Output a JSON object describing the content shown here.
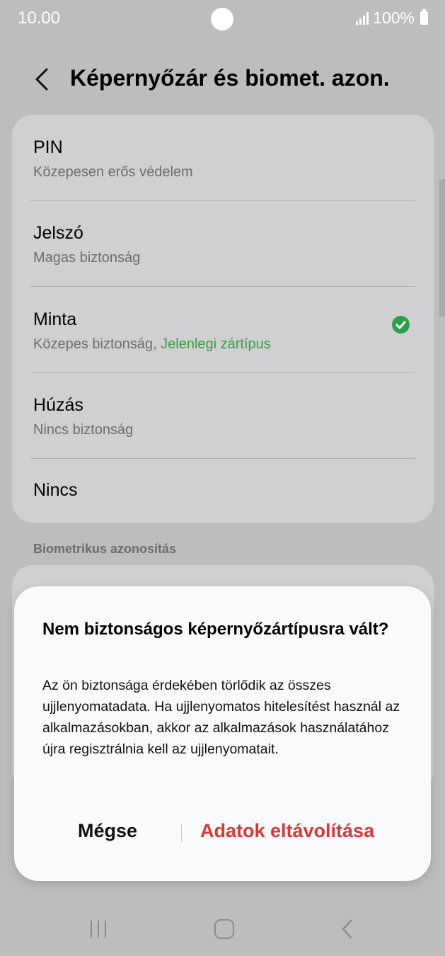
{
  "status": {
    "time": "10.00",
    "battery": "100%"
  },
  "header": {
    "title": "Képernyőzár és biomet. azon."
  },
  "options": [
    {
      "title": "PIN",
      "subtitle": "Közepesen erős védelem"
    },
    {
      "title": "Jelszó",
      "subtitle": "Magas biztonság"
    },
    {
      "title": "Minta",
      "subtitle": "Közepes biztonság, ",
      "current": "Jelenlegi zártípus",
      "selected": true
    },
    {
      "title": "Húzás",
      "subtitle": "Nincs biztonság"
    },
    {
      "title": "Nincs"
    }
  ],
  "section": {
    "biometrics_label": "Biometrikus azonosítás"
  },
  "dialog": {
    "title": "Nem biztonságos képernyőzártípusra vált?",
    "body": "Az ön biztonsága érdekében törlődik az összes ujjlenyomatadata. Ha ujjlenyomatos hitelesítést használ az alkalmazásokban, akkor az alkalmazások használatához újra regisztrálnia kell az ujjlenyomatait.",
    "cancel_label": "Mégse",
    "confirm_label": "Adatok eltávolítása"
  },
  "colors": {
    "accent_green": "#2e9e49",
    "destructive_red": "#d33a3a"
  }
}
